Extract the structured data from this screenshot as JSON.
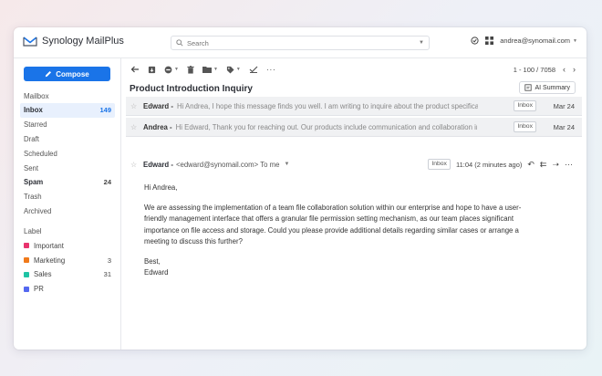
{
  "app": {
    "title": "Synology MailPlus"
  },
  "search": {
    "placeholder": "Search"
  },
  "account": {
    "email": "andrea@synomail.com"
  },
  "sidebar": {
    "compose_label": "Compose",
    "mailbox_label": "Mailbox",
    "mailbox": [
      {
        "name": "Inbox",
        "count": "149",
        "active": true,
        "bold": true
      },
      {
        "name": "Starred",
        "count": ""
      },
      {
        "name": "Draft",
        "count": ""
      },
      {
        "name": "Scheduled",
        "count": ""
      },
      {
        "name": "Sent",
        "count": ""
      },
      {
        "name": "Spam",
        "count": "24",
        "bold": true
      },
      {
        "name": "Trash",
        "count": ""
      },
      {
        "name": "Archived",
        "count": ""
      }
    ],
    "label_label": "Label",
    "labels": [
      {
        "name": "Important",
        "count": "",
        "color": "#e8336d"
      },
      {
        "name": "Marketing",
        "count": "3",
        "color": "#f07a1b"
      },
      {
        "name": "Sales",
        "count": "31",
        "color": "#1fc3a4"
      },
      {
        "name": "PR",
        "count": "",
        "color": "#5468f0"
      }
    ]
  },
  "toolbar": {
    "pager": "1 - 100 / 7058"
  },
  "thread": {
    "subject": "Product Introduction Inquiry",
    "ai_summary_label": "AI Summary",
    "messages": [
      {
        "sender": "Edward -",
        "snippet": "Hi Andrea, I hope this message finds you well. I am writing to inquire about the product specification...",
        "tag": "Inbox",
        "date": "Mar 24"
      },
      {
        "sender": "Andrea -",
        "snippet": "Hi Edward, Thank you for reaching out. Our products include communication and collaboration in a p...",
        "tag": "Inbox",
        "date": "Mar 24"
      }
    ],
    "open": {
      "sender": "Edward -",
      "address": "<edward@synomail.com> To me",
      "tag": "Inbox",
      "time": "11:04 (2 minutes ago)",
      "greeting": "Hi Andrea,",
      "paragraph": "We are assessing the implementation of a team file collaboration solution within our enterprise and hope to have a user-friendly management interface that offers a granular file permission setting mechanism, as our team places significant importance on file access and storage. Could you please provide additional details regarding similar cases or arrange a meeting to discuss this further?",
      "closing": "Best,",
      "signature": "Edward"
    }
  },
  "colors": {
    "accent": "#1a74e8"
  }
}
